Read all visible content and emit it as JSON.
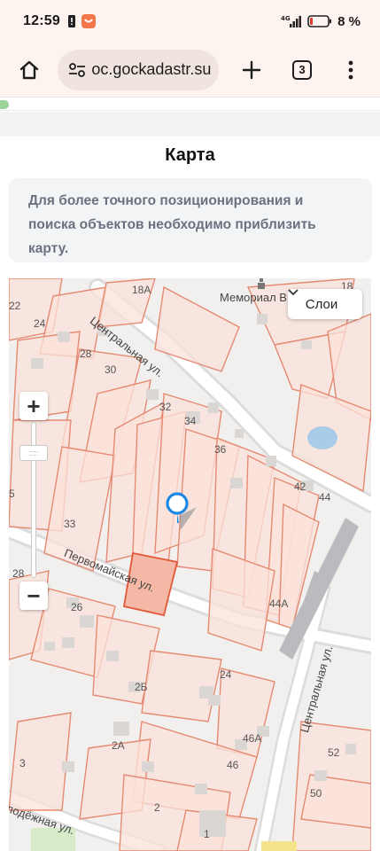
{
  "status_bar": {
    "time": "12:59",
    "battery_percent": "8 %",
    "network": "4G",
    "icons": [
      "sim-alert-icon",
      "app-notification-icon",
      "signal-icon",
      "battery-icon"
    ]
  },
  "browser": {
    "url": "oc.gockadastr.su",
    "tab_count": "3",
    "icons": [
      "home-icon",
      "site-settings-icon",
      "new-tab-icon",
      "tabs-icon",
      "menu-icon"
    ]
  },
  "card": {
    "title": "Карта",
    "notice": "Для более точного позиционирования и поиска объектов необходимо приблизить карту."
  },
  "map": {
    "layers_button": "Слои",
    "zoom_in": "+",
    "zoom_out": "−",
    "zoom_handle": "::::",
    "street_labels": {
      "tsentralnaya_top": "Центральная ул.",
      "tsentralnaya_bottom": "Центральная ул.",
      "pervomayskaya": "Первомайская ул.",
      "molodezhnaya": "лодёжная ул."
    },
    "poi_label": "Мемориал В",
    "house_numbers": {
      "n18a": "18А",
      "n18": "18",
      "n22": "22",
      "n24": "24",
      "n28a": "28",
      "n30": "30",
      "n32": "32",
      "n34": "34",
      "n36": "36",
      "n42": "42",
      "n44": "44",
      "n5": "5",
      "n33": "33",
      "n28b": "28",
      "n26": "26",
      "n44a": "44А",
      "n24b": "24",
      "n2b": "2Б",
      "n2a": "2А",
      "n3": "3",
      "n46a": "46А",
      "n46": "46",
      "n52": "52",
      "n50": "50",
      "n2": "2",
      "n1": "1"
    },
    "accent_parcel": "#e05a3a",
    "pin_color": "#1e88e5"
  }
}
